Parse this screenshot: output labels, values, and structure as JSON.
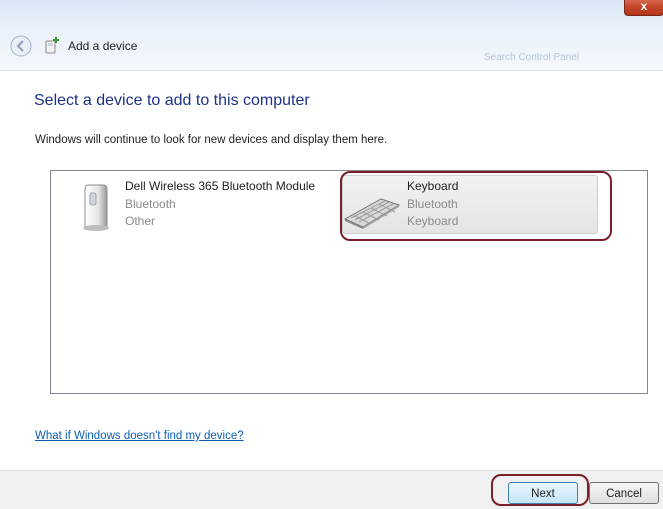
{
  "window": {
    "close_glyph": "x",
    "title": "Add a device",
    "search_placeholder": "Search Control Panel"
  },
  "main": {
    "heading": "Select a device to add to this computer",
    "subtext": "Windows will continue to look for new devices and display them here."
  },
  "devices": [
    {
      "name": "Dell Wireless 365 Bluetooth Module",
      "type": "Bluetooth",
      "category": "Other",
      "icon": "bluetooth-module-icon",
      "selected": false
    },
    {
      "name": "Keyboard",
      "type": "Bluetooth",
      "category": "Keyboard",
      "icon": "keyboard-icon",
      "selected": true
    }
  ],
  "help_link": "What if Windows doesn't find my device?",
  "buttons": {
    "next": "Next",
    "cancel": "Cancel"
  },
  "colors": {
    "heading": "#1e3287",
    "link": "#0a5fb4",
    "annotation": "#7b1f2b"
  }
}
